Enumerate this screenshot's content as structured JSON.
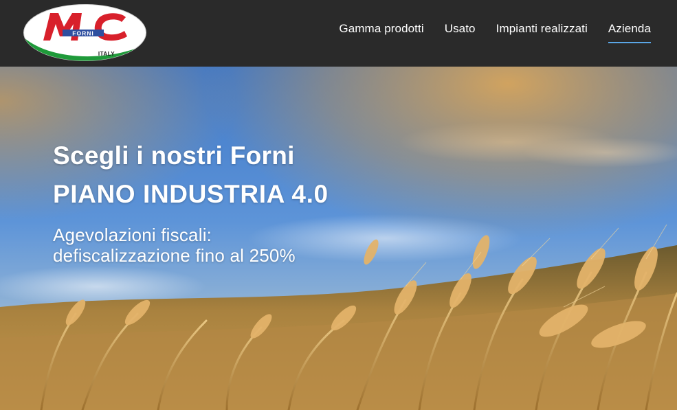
{
  "logo": {
    "letters": "MC",
    "word": "FORNI",
    "country": "ITALY",
    "colors": {
      "red": "#d8202b",
      "blue": "#2e4fa0",
      "green": "#1f9a3a"
    }
  },
  "nav": {
    "items": [
      {
        "label": "Gamma prodotti"
      },
      {
        "label": "Usato"
      },
      {
        "label": "Impianti realizzati"
      },
      {
        "label": "Azienda",
        "active": true
      }
    ],
    "active_underline_color": "#5aa6e6"
  },
  "hero": {
    "line1": "Scegli i nostri Forni",
    "line2": "PIANO INDUSTRIA 4.0",
    "line3": "Agevolazioni fiscali:",
    "line4": "defiscalizzazione fino al 250%"
  }
}
